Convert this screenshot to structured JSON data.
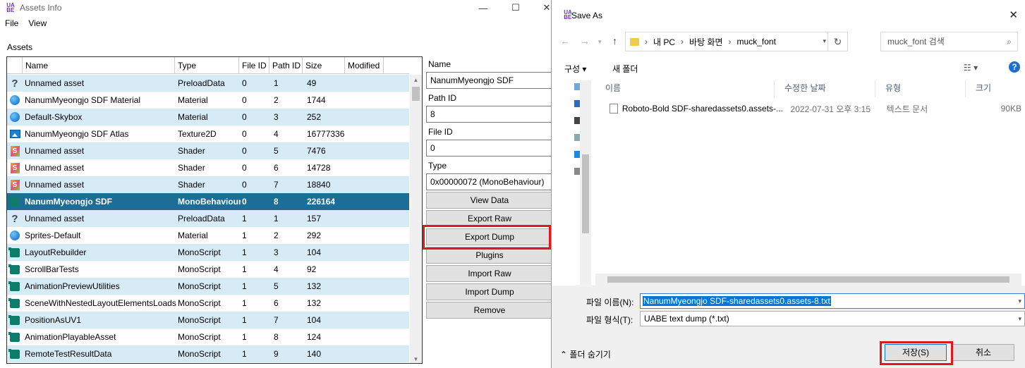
{
  "assets_window": {
    "title": "Assets Info",
    "menu": [
      "File",
      "View"
    ],
    "section_label": "Assets",
    "columns": [
      "Name",
      "Type",
      "File ID",
      "Path ID",
      "Size",
      "Modified"
    ],
    "rows": [
      {
        "icon": "question-icon",
        "name": "Unnamed asset",
        "type": "PreloadData",
        "file_id": "0",
        "path_id": "1",
        "size": "49"
      },
      {
        "icon": "material-icon",
        "name": "NanumMyeongjo SDF Material",
        "type": "Material",
        "file_id": "0",
        "path_id": "2",
        "size": "1744"
      },
      {
        "icon": "material-icon",
        "name": "Default-Skybox",
        "type": "Material",
        "file_id": "0",
        "path_id": "3",
        "size": "252"
      },
      {
        "icon": "texture-icon",
        "name": "NanumMyeongjo SDF Atlas",
        "type": "Texture2D",
        "file_id": "0",
        "path_id": "4",
        "size": "16777336"
      },
      {
        "icon": "shader-icon",
        "name": "Unnamed asset",
        "type": "Shader",
        "file_id": "0",
        "path_id": "5",
        "size": "7476"
      },
      {
        "icon": "shader-icon",
        "name": "Unnamed asset",
        "type": "Shader",
        "file_id": "0",
        "path_id": "6",
        "size": "14728"
      },
      {
        "icon": "shader-icon",
        "name": "Unnamed asset",
        "type": "Shader",
        "file_id": "0",
        "path_id": "7",
        "size": "18840"
      },
      {
        "icon": "monobehaviour-icon",
        "name": "NanumMyeongjo SDF",
        "type": "MonoBehaviour",
        "file_id": "0",
        "path_id": "8",
        "size": "226164"
      },
      {
        "icon": "question-icon",
        "name": "Unnamed asset",
        "type": "PreloadData",
        "file_id": "1",
        "path_id": "1",
        "size": "157"
      },
      {
        "icon": "material-icon",
        "name": "Sprites-Default",
        "type": "Material",
        "file_id": "1",
        "path_id": "2",
        "size": "292"
      },
      {
        "icon": "monoscript-icon",
        "name": "LayoutRebuilder",
        "type": "MonoScript",
        "file_id": "1",
        "path_id": "3",
        "size": "104"
      },
      {
        "icon": "monoscript-icon",
        "name": "ScrollBarTests",
        "type": "MonoScript",
        "file_id": "1",
        "path_id": "4",
        "size": "92"
      },
      {
        "icon": "monoscript-icon",
        "name": "AnimationPreviewUtilities",
        "type": "MonoScript",
        "file_id": "1",
        "path_id": "5",
        "size": "132"
      },
      {
        "icon": "monoscript-icon",
        "name": "SceneWithNestedLayoutElementsLoads",
        "type": "MonoScript",
        "file_id": "1",
        "path_id": "6",
        "size": "132"
      },
      {
        "icon": "monoscript-icon",
        "name": "PositionAsUV1",
        "type": "MonoScript",
        "file_id": "1",
        "path_id": "7",
        "size": "104"
      },
      {
        "icon": "monoscript-icon",
        "name": "AnimationPlayableAsset",
        "type": "MonoScript",
        "file_id": "1",
        "path_id": "8",
        "size": "124"
      },
      {
        "icon": "monoscript-icon",
        "name": "RemoteTestResultData",
        "type": "MonoScript",
        "file_id": "1",
        "path_id": "9",
        "size": "140"
      }
    ],
    "selected_row": 7,
    "panel": {
      "name_label": "Name",
      "name_value": "NanumMyeongjo SDF",
      "path_id_label": "Path ID",
      "path_id_value": "8",
      "file_id_label": "File ID",
      "file_id_value": "0",
      "type_label": "Type",
      "type_value": "0x00000072 (MonoBehaviour)",
      "buttons": [
        "View Data",
        "Export Raw",
        "Export Dump",
        "Plugins",
        "Import Raw",
        "Import Dump",
        "Remove"
      ]
    }
  },
  "save_dialog": {
    "title": "Save As",
    "breadcrumb": [
      "내 PC",
      "바탕 화면",
      "muck_font"
    ],
    "search_placeholder": "muck_font 검색",
    "organize_label": "구성 ▾",
    "new_folder_label": "새 폴더",
    "columns": [
      "이름",
      "수정한 날짜",
      "유형",
      "크기"
    ],
    "files": [
      {
        "name": "Roboto-Bold SDF-sharedassets0.assets-...",
        "modified": "2022-07-31 오후 3:15",
        "type": "텍스트 문서",
        "size": "90KB"
      }
    ],
    "filename_label": "파일 이름(N):",
    "filename_value": "NanumMyeongjo SDF-sharedassets0.assets-8.txt",
    "filetype_label": "파일 형식(T):",
    "filetype_value": "UABE text dump (*.txt)",
    "hide_folders_label": "폴더 숨기기",
    "save_label": "저장(S)",
    "cancel_label": "취소"
  },
  "colors": {
    "selected_row": "#1c6e99",
    "alt_row": "#d7ebf6",
    "highlight_box": "#e0191e"
  }
}
